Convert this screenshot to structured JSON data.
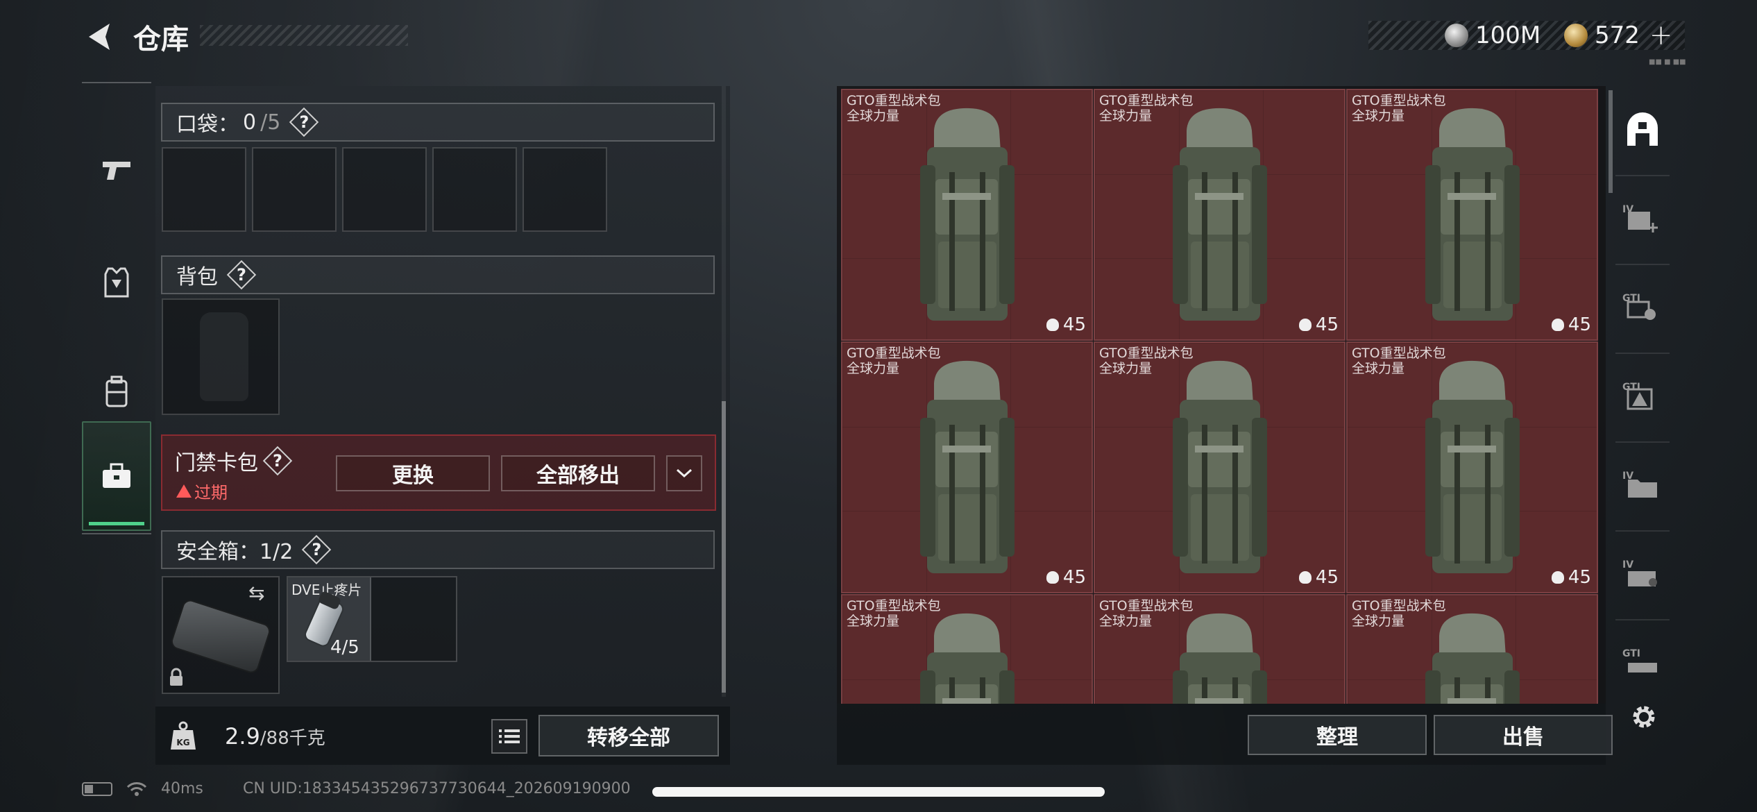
{
  "header": {
    "title": "仓库",
    "tiny_label": "■■ ■ ■■"
  },
  "currency": [
    {
      "icon": "silver-coin-icon",
      "value": "100M"
    },
    {
      "icon": "gold-coin-icon",
      "value": "572"
    }
  ],
  "currency_plus": "+",
  "left_rail": [
    {
      "icon": "pistol-icon",
      "active": false
    },
    {
      "icon": "armor-vest-icon",
      "active": false
    },
    {
      "icon": "backpack-icon",
      "active": false
    },
    {
      "icon": "toolbox-icon",
      "active": true
    }
  ],
  "pocket": {
    "label": "口袋：",
    "current": "0",
    "max": "/5",
    "help": "?"
  },
  "backpack": {
    "label": "背包",
    "help": "?"
  },
  "keycard": {
    "label": "门禁卡包",
    "help": "?",
    "status": "过期",
    "replace_label": "更换",
    "remove_all_label": "全部移出"
  },
  "safe_box": {
    "label": "安全箱：1/2",
    "help": "?"
  },
  "safe_item": {
    "name": "DVE止疼片",
    "count": "4/5"
  },
  "weight": {
    "current": "2.9",
    "max": "/88千克"
  },
  "transfer_all_label": "转移全部",
  "grid_items": [
    {
      "name": "GTO重型战术包",
      "sub": "全球力量",
      "count": "45"
    },
    {
      "name": "GTO重型战术包",
      "sub": "全球力量",
      "count": "45"
    },
    {
      "name": "GTO重型战术包",
      "sub": "全球力量",
      "count": "45"
    },
    {
      "name": "GTO重型战术包",
      "sub": "全球力量",
      "count": "45"
    },
    {
      "name": "GTO重型战术包",
      "sub": "全球力量",
      "count": "45"
    },
    {
      "name": "GTO重型战术包",
      "sub": "全球力量",
      "count": "45"
    },
    {
      "name": "GTO重型战术包",
      "sub": "全球力量",
      "count": ""
    },
    {
      "name": "GTO重型战术包",
      "sub": "全球力量",
      "count": ""
    },
    {
      "name": "GTO重型战术包",
      "sub": "全球力量",
      "count": ""
    }
  ],
  "organize_label": "整理",
  "sell_label": "出售",
  "filter_rail": [
    {
      "icon": "storage-home-icon",
      "label": ""
    },
    {
      "icon": "medkit-add-icon",
      "label": "IV"
    },
    {
      "icon": "tactical-gear-icon",
      "label": "GTI"
    },
    {
      "icon": "gti-warning-icon",
      "label": "GTI"
    },
    {
      "icon": "iv-folder-icon",
      "label": "IV"
    },
    {
      "icon": "iv-crate-icon",
      "label": "IV"
    },
    {
      "icon": "gti-tray-icon",
      "label": "GTI"
    }
  ],
  "status": {
    "ping": "40ms",
    "uid": "CN UID:1833454352967377306​44_202609190900"
  },
  "colors": {
    "cell_bg": "#5c2a2c",
    "active_rail": "#4fd18b",
    "expired": "#ff6a6a"
  }
}
